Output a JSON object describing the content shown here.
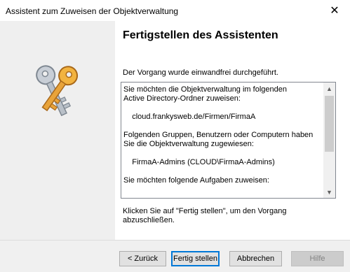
{
  "window": {
    "title": "Assistent zum Zuweisen der Objektverwaltung",
    "close_glyph": "✕"
  },
  "header": {
    "heading": "Fertigstellen des Assistenten"
  },
  "status": "Der Vorgang wurde einwandfrei durchgeführt.",
  "summary": {
    "text": "Sie möchten die Objektverwaltung im folgenden\nActive Directory-Ordner zuweisen:\n\n    cloud.frankysweb.de/Firmen/FirmaA\n\nFolgenden Gruppen, Benutzern oder Computern haben\nSie die Objektverwaltung zugewiesen:\n\n    FirmaA-Admins (CLOUD\\FirmaA-Admins)\n\nSie möchten folgende Aufgaben zuweisen:",
    "scroll_up_glyph": "▲",
    "scroll_down_glyph": "▼"
  },
  "finish_note": "Klicken Sie auf \"Fertig stellen\", um den Vorgang abzuschließen.",
  "buttons": {
    "back": "< Zurück",
    "finish": "Fertig stellen",
    "cancel": "Abbrechen",
    "help": "Hilfe"
  },
  "icons": {
    "wizard_graphic": "keys-icon"
  },
  "colors": {
    "accent": "#0078d7",
    "left_panel": "#efefef",
    "key_gold": "#e8a33a",
    "key_silver": "#b9c0c8"
  }
}
